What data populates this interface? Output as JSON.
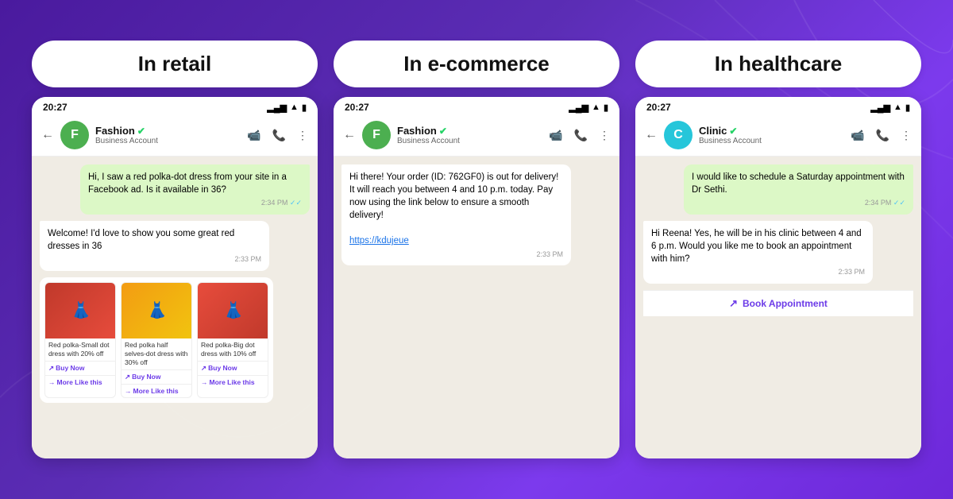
{
  "panels": [
    {
      "id": "retail",
      "title": "In retail",
      "avatar_letter": "F",
      "avatar_class": "avatar-f",
      "chat_name": "Fashion",
      "chat_sub": "Business Account",
      "time": "20:27",
      "messages": [
        {
          "type": "sent",
          "text": "Hi, I saw a red polka-dot dress from your site in a Facebook ad. Is it available in 36?",
          "time": "2:34 PM",
          "ticks": true
        },
        {
          "type": "received",
          "text": "Welcome! I'd love to show you some great red dresses in 36",
          "time": "2:33 PM"
        }
      ],
      "products": [
        {
          "color": "red",
          "desc": "Red polka-Small dot dress with 20% off",
          "btn": "Buy Now",
          "more": "More Like this"
        },
        {
          "color": "yellow",
          "desc": "Red polka half selves-dot dress with 30% off",
          "btn": "Buy Now",
          "more": "More Like this"
        },
        {
          "color": "pink",
          "desc": "Red polka-Big dot dress with 10% off",
          "btn": "Buy Now",
          "more": "More Like this"
        }
      ]
    },
    {
      "id": "ecommerce",
      "title": "In e-commerce",
      "avatar_letter": "F",
      "avatar_class": "avatar-f",
      "chat_name": "Fashion",
      "chat_sub": "Business Account",
      "time": "20:27",
      "messages": [
        {
          "type": "received",
          "text": "Hi there! Your order (ID: 762GF0) is out for delivery! It will reach you between 4 and 10 p.m. today. Pay now using the link below to ensure a smooth delivery!",
          "link": "https://kdujeue",
          "time": "2:33 PM"
        }
      ]
    },
    {
      "id": "healthcare",
      "title": "In healthcare",
      "avatar_letter": "C",
      "avatar_class": "avatar-c",
      "chat_name": "Clinic",
      "chat_sub": "Business Account",
      "time": "20:27",
      "messages": [
        {
          "type": "sent",
          "text": "I would like to schedule a Saturday appointment with Dr Sethi.",
          "time": "2:34 PM",
          "ticks": true
        },
        {
          "type": "received",
          "text": "Hi Reena! Yes, he will be in his clinic between 4 and 6 p.m. Would you like me to book an appointment with him?",
          "time": "2:33 PM"
        }
      ],
      "action_btn": "Book  Appointment"
    }
  ]
}
